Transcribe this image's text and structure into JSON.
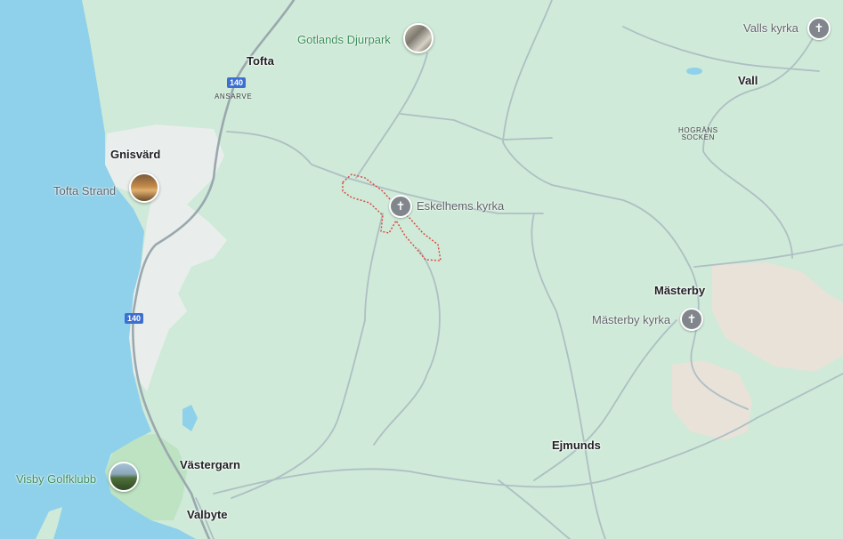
{
  "map": {
    "colors": {
      "water": "#8fd1ea",
      "land": "#cfead8",
      "urban": "#e9eeec",
      "road": "#aebfc4",
      "highway": "#9aa8ae",
      "boundary": "#d9443b",
      "golf": "#bde3c2"
    },
    "route_shields": [
      "140",
      "140"
    ],
    "places": {
      "tofta": "Tofta",
      "ansarve": "ANSARVE",
      "gnisvard": "Gnisvärd",
      "vall": "Vall",
      "hograns_line1": "HOGRÄNS",
      "hograns_line2": "SOCKEN",
      "masterby": "Mästerby",
      "ejmunds": "Ejmunds",
      "vastergarn": "Västergarn",
      "valbyte": "Valbyte"
    },
    "pois": {
      "djurpark": "Gotlands Djurpark",
      "valls_kyrka": "Valls kyrka",
      "tofta_strand": "Tofta Strand",
      "eskelhems_kyrka": "Eskelhems kyrka",
      "masterby_kyrka": "Mästerby kyrka",
      "golfklubb": "Visby Golfklubb"
    },
    "icons": {
      "church": "church-cross-icon",
      "photo": "place-photo-thumbnail"
    }
  }
}
